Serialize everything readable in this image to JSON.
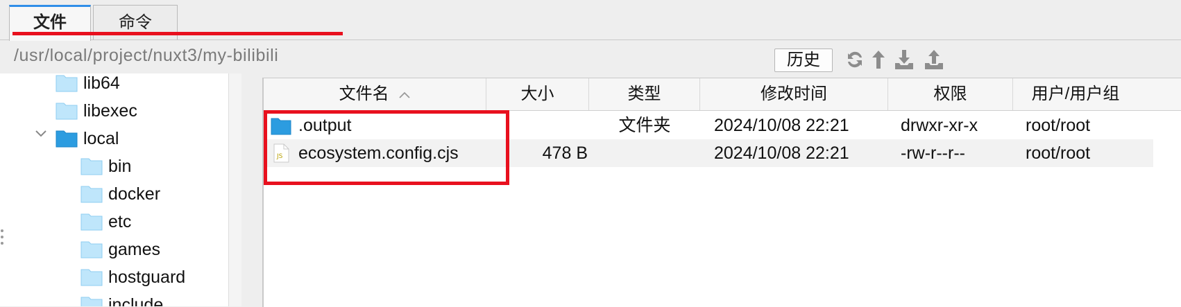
{
  "tabs": [
    {
      "label": "文件",
      "active": true
    },
    {
      "label": "命令",
      "active": false
    }
  ],
  "path": {
    "current": "/usr/local/project/nuxt3/my-bilibili",
    "history_label": "历史",
    "toolbar_icons": [
      "refresh-icon",
      "up-directory-icon",
      "download-icon",
      "upload-icon"
    ]
  },
  "tree": {
    "items": [
      {
        "label": "lib64",
        "depth": 1,
        "expanded": false
      },
      {
        "label": "libexec",
        "depth": 1,
        "expanded": false
      },
      {
        "label": "local",
        "depth": 1,
        "expanded": true
      },
      {
        "label": "bin",
        "depth": 2,
        "expanded": false
      },
      {
        "label": "docker",
        "depth": 2,
        "expanded": false
      },
      {
        "label": "etc",
        "depth": 2,
        "expanded": false
      },
      {
        "label": "games",
        "depth": 2,
        "expanded": false
      },
      {
        "label": "hostguard",
        "depth": 2,
        "expanded": false
      },
      {
        "label": "include",
        "depth": 2,
        "expanded": false
      }
    ]
  },
  "table": {
    "columns": [
      "文件名",
      "大小",
      "类型",
      "修改时间",
      "权限",
      "用户/用户组"
    ],
    "sort_column": "文件名",
    "sort_direction": "ascending",
    "rows": [
      {
        "icon": "folder-icon",
        "name": ".output",
        "size": "",
        "type": "文件夹",
        "mtime": "2024/10/08 22:21",
        "perm": "drwxr-xr-x",
        "owner": "root/root"
      },
      {
        "icon": "js-file-icon",
        "name": "ecosystem.config.cjs",
        "size": "478 B",
        "type": "",
        "mtime": "2024/10/08 22:21",
        "perm": "-rw-r--r--",
        "owner": "root/root"
      }
    ]
  },
  "colors": {
    "accent": "#2f8ee8",
    "annotation_red": "#e8101e",
    "folder_blue": "#2c9ce0",
    "folder_light": "#bfe6fb"
  }
}
